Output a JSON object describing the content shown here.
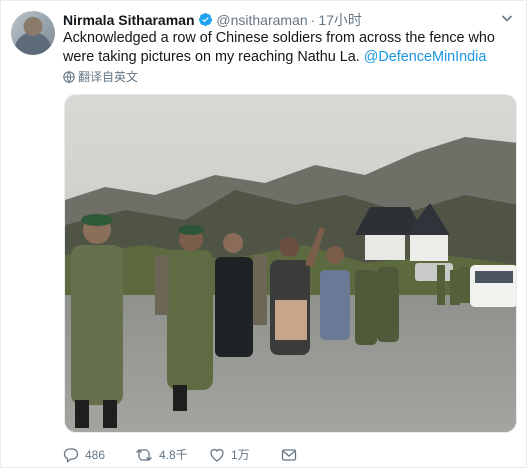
{
  "tweet": {
    "author_name": "Nirmala Sitharaman",
    "handle": "@nsitharaman",
    "separator": "·",
    "time": "17小时",
    "text_main": "Acknowledged a row of Chinese soldiers from across the fence who were taking pictures on my reaching Nathu La.",
    "mention": "@DefenceMinIndia",
    "translate_label": "翻译自英文",
    "accent_color": "#1b95e0"
  },
  "actions": {
    "reply_count": "486",
    "retweet_count": "4.8千",
    "like_count": "1万"
  },
  "icons": {
    "avatar": "profile-photo",
    "verified": "verified-badge-icon",
    "more": "chevron-down-icon",
    "globe": "globe-icon",
    "reply": "reply-icon",
    "retweet": "retweet-icon",
    "like": "heart-icon",
    "dm": "envelope-icon"
  }
}
